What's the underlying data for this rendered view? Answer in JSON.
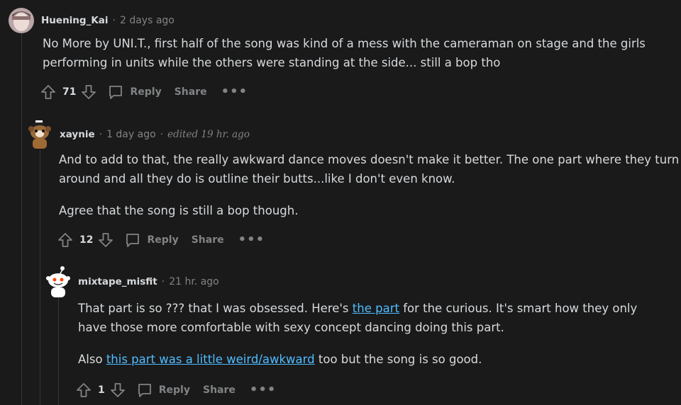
{
  "comments": [
    {
      "author": "Huening_Kai",
      "time": "2 days ago",
      "edited": "",
      "paragraphs": [
        [
          "No More by UNI.T., first half of the song was kind of a mess with the cameraman on stage and the girls performing in units while the others were standing at the side... still a bop tho"
        ]
      ],
      "votes": "71",
      "reply_label": "Reply",
      "share_label": "Share"
    },
    {
      "author": "xaynie",
      "time": "1 day ago",
      "edited": "edited 19 hr. ago",
      "paragraphs": [
        [
          "And to add to that, the really awkward dance moves doesn't make it better. The one part where they turn around and all they do is outline their butts...like I don't even know."
        ],
        [
          "Agree that the song is still a bop though."
        ]
      ],
      "votes": "12",
      "reply_label": "Reply",
      "share_label": "Share"
    },
    {
      "author": "mixtape_misfit",
      "time": "21 hr. ago",
      "edited": "",
      "paragraph1": {
        "before": "That part is so ??? that I was obsessed. Here's ",
        "link": "the part",
        "after": " for the curious. It's smart how they only have those more comfortable with sexy concept dancing doing this part."
      },
      "paragraph2": {
        "before": "Also ",
        "link": "this part was a little weird/awkward",
        "after": " too but the song is so good."
      },
      "votes": "1",
      "reply_label": "Reply",
      "share_label": "Share"
    }
  ],
  "separator": "·",
  "more_glyph": "•••",
  "colors": {
    "background": "#1a1a1b",
    "text": "#d7dadc",
    "muted": "#818384",
    "link": "#4fbcff"
  }
}
